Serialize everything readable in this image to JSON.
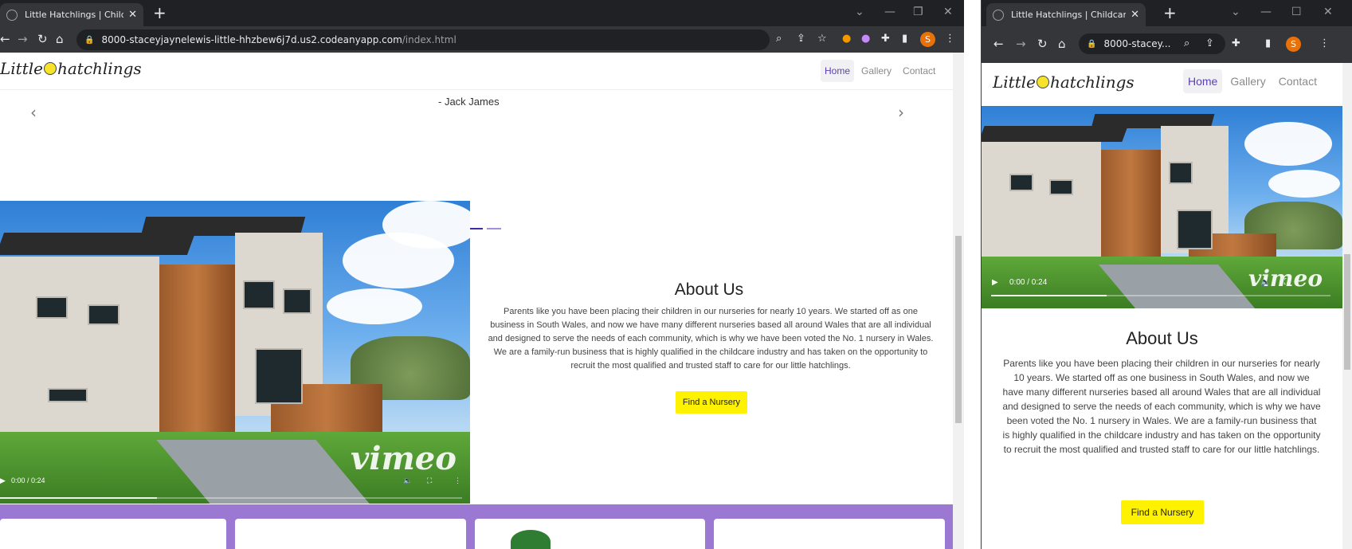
{
  "left_window": {
    "tab_title": "Little Hatchlings | Childcare Nurs",
    "url_main": "8000-staceyjaynelewis-little-hhzbew6j7d.us2.codeanyapp.com",
    "url_path": "/index.html",
    "profile_letter": "S"
  },
  "right_window": {
    "tab_title": "Little Hatchlings | Childcare N",
    "url_main": "8000-stacey...",
    "profile_letter": "S"
  },
  "site": {
    "logo_left": "Little",
    "logo_right": "hatchlings",
    "nav": [
      {
        "label": "Home",
        "active": true
      },
      {
        "label": "Gallery",
        "active": false
      },
      {
        "label": "Contact",
        "active": false
      }
    ],
    "testimonial_author": "- Jack James",
    "carousel_count": 3,
    "carousel_active": 2,
    "video_time": "0:00 / 0:24",
    "video_progress": 0.34,
    "video_brand": "vimeo",
    "about_title": "About Us",
    "about_text": "Parents like you have been placing their children in our nurseries for nearly 10 years. We started off as one business in South Wales, and now we have many different nurseries based all around Wales that are all individual and designed to serve the needs of each community, which is why we have been voted the No. 1 nursery in Wales. We are a family-run business that is highly qualified in the childcare industry and has taken on the opportunity to recruit the most qualified and trusted staff to care for our little hatchlings.",
    "cta_label": "Find a Nursery"
  },
  "colors": {
    "accent": "#5b3fb0",
    "cta": "#fff200",
    "band": "#9b79d2",
    "chrome_dark": "#202124",
    "chrome_toolbar": "#35363a"
  }
}
